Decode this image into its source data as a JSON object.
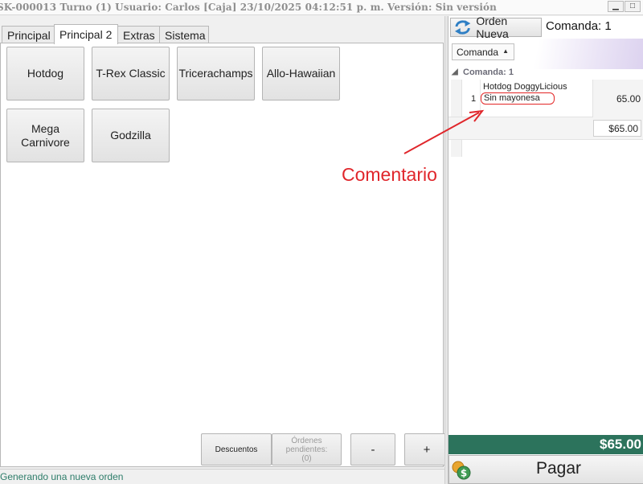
{
  "window": {
    "title": "SK-000013 Turno (1) Usuario: Carlos [Caja] 23/10/2025 04:12:51 p. m. Versión: Sin versión",
    "minimize_glyph": "▁",
    "maximize_glyph": "□"
  },
  "tabs": [
    {
      "label": "Principal",
      "active": false
    },
    {
      "label": "Principal 2",
      "active": true
    },
    {
      "label": "Extras",
      "active": false
    },
    {
      "label": "Sistema",
      "active": false
    }
  ],
  "products": [
    {
      "label": "Hotdog"
    },
    {
      "label": "T-Rex Classic"
    },
    {
      "label": "Tricerachamps"
    },
    {
      "label": "Allo-Hawaiian"
    },
    {
      "label": "Mega Carnivore"
    },
    {
      "label": "Godzilla"
    }
  ],
  "bottom_buttons": {
    "descuentos": "Descuentos",
    "ordenes_pendientes": "Órdenes pendientes: (0)",
    "minus": "-",
    "plus": "+"
  },
  "status": {
    "text": "Generando una nueva orden"
  },
  "order": {
    "new_order_label": "Orden Nueva",
    "title": "Comanda: 1",
    "dropdown_value": "Comanda",
    "dropdown_arrow": "▲",
    "group_label": "Comanda: 1",
    "group_toggle": "◢",
    "items": [
      {
        "qty": "1",
        "name": "Hotdog DoggyLicious",
        "comment": "Sin mayonesa",
        "price": "65.00"
      }
    ],
    "subtotal": "$65.00",
    "grand_total": "$65.00",
    "pay_label": "Pagar"
  },
  "annotation": {
    "text": "Comentario",
    "color": "#e0262b"
  },
  "colors": {
    "total_bar": "#2c735c",
    "status_text": "#2e7d6a",
    "annotation": "#e0262b"
  },
  "icons": {
    "new_order": "refresh-icon",
    "pay": "coins-icon"
  }
}
